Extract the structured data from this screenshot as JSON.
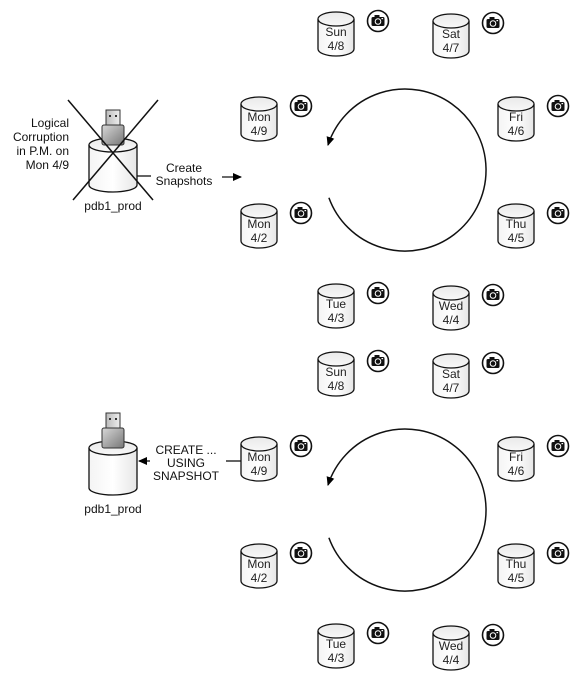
{
  "panels": [
    {
      "id": "top",
      "prod_db": {
        "label": "pdb1_prod",
        "crossed_out": true,
        "note_lines": [
          "Logical",
          "Corruption",
          "in P.M. on",
          "Mon 4/9"
        ]
      },
      "action": {
        "lines": [
          "Create",
          "Snapshots"
        ],
        "direction": "to-snapshots"
      },
      "cycle_direction": "counterclockwise",
      "snapshots": [
        {
          "day": "Sun",
          "date": "4/8",
          "slot": "top-left"
        },
        {
          "day": "Sat",
          "date": "4/7",
          "slot": "top-right"
        },
        {
          "day": "Mon",
          "date": "4/9",
          "slot": "upper-left"
        },
        {
          "day": "Fri",
          "date": "4/6",
          "slot": "upper-right"
        },
        {
          "day": "Mon",
          "date": "4/2",
          "slot": "lower-left"
        },
        {
          "day": "Thu",
          "date": "4/5",
          "slot": "lower-right"
        },
        {
          "day": "Tue",
          "date": "4/3",
          "slot": "bottom-left"
        },
        {
          "day": "Wed",
          "date": "4/4",
          "slot": "bottom-right"
        }
      ]
    },
    {
      "id": "bottom",
      "prod_db": {
        "label": "pdb1_prod",
        "crossed_out": false,
        "note_lines": []
      },
      "action": {
        "lines": [
          "CREATE ...",
          "USING",
          "SNAPSHOT"
        ],
        "direction": "to-prod"
      },
      "cycle_direction": "counterclockwise",
      "snapshots": [
        {
          "day": "Sun",
          "date": "4/8",
          "slot": "top-left"
        },
        {
          "day": "Sat",
          "date": "4/7",
          "slot": "top-right"
        },
        {
          "day": "Mon",
          "date": "4/9",
          "slot": "upper-left"
        },
        {
          "day": "Fri",
          "date": "4/6",
          "slot": "upper-right"
        },
        {
          "day": "Mon",
          "date": "4/2",
          "slot": "lower-left"
        },
        {
          "day": "Thu",
          "date": "4/5",
          "slot": "lower-right"
        },
        {
          "day": "Tue",
          "date": "4/3",
          "slot": "bottom-left"
        },
        {
          "day": "Wed",
          "date": "4/4",
          "slot": "bottom-right"
        }
      ]
    }
  ],
  "icons": {
    "snapshot": "camera-icon",
    "pdb": "usb-drive-icon",
    "database": "database-cylinder-icon"
  }
}
